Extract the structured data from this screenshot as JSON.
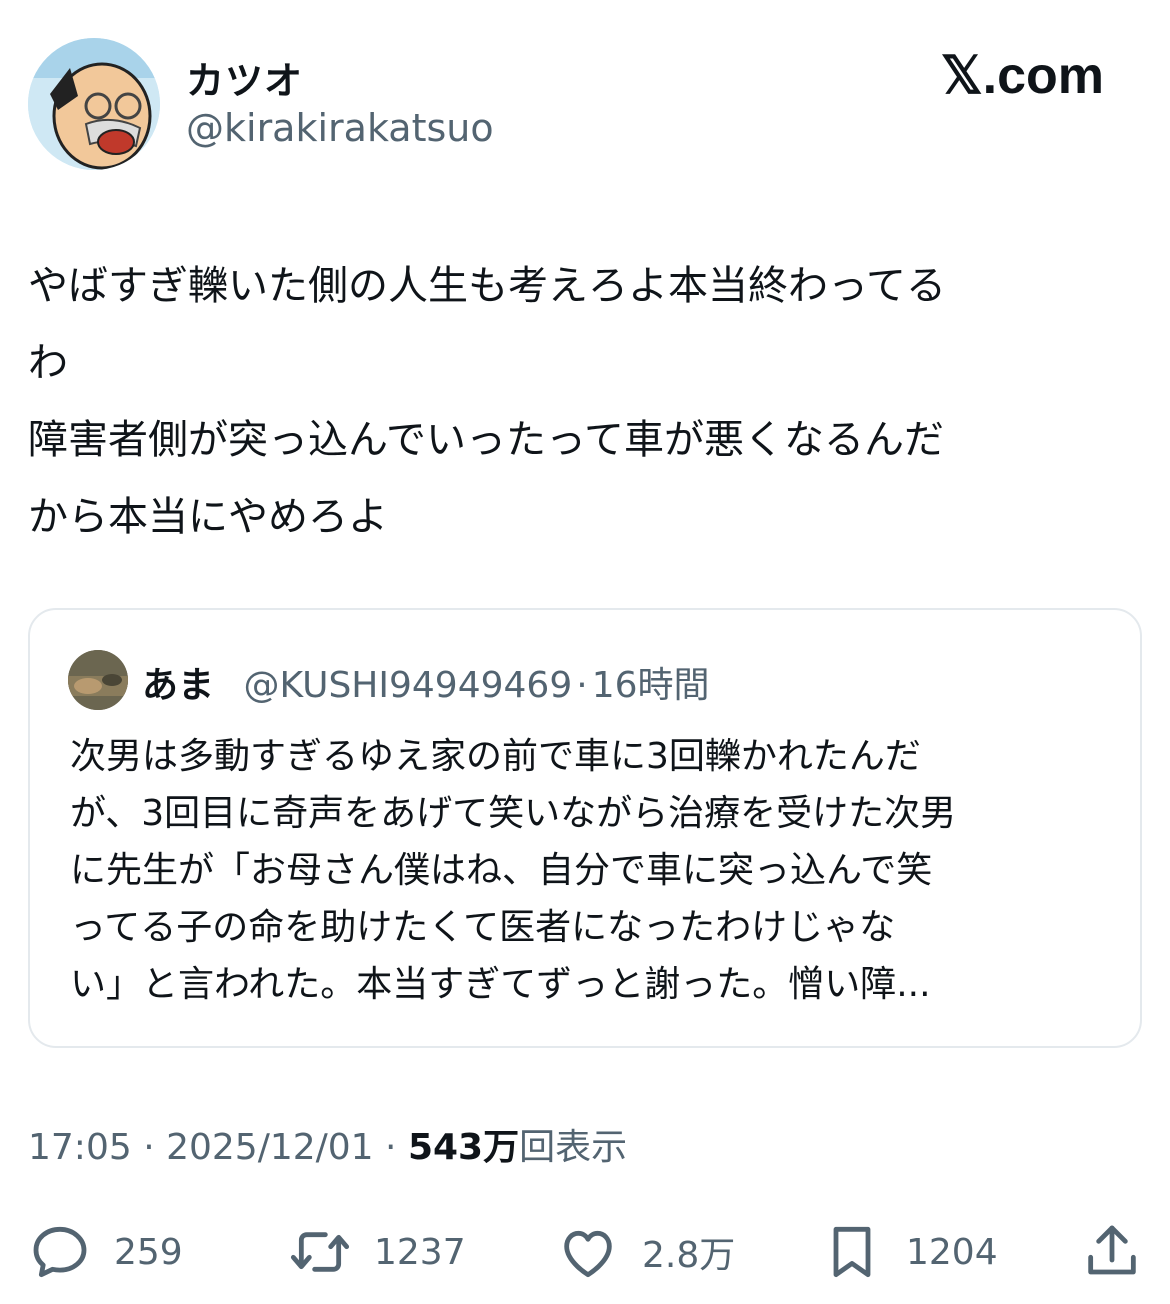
{
  "author": {
    "display_name": "カツオ",
    "handle": "@kirakirakatsuo",
    "avatar_icon": "avatar-cartoon-old-man-icon"
  },
  "brand": "𝕏.com",
  "tweet": {
    "text": "やばすぎ轢いた側の人生も考えろよ本当終わってる\nわ\n障害者側が突っ込んでいったって車が悪くなるんだ\nから本当にやめろよ"
  },
  "quote": {
    "name": "あま",
    "handle": "@KUSHI94949469",
    "dot": "·",
    "time": "16時間",
    "avatar_icon": "avatar-photo-icon",
    "text": "次男は多動すぎるゆえ家の前で車に3回轢かれたんだ\nが、3回目に奇声をあげて笑いながら治療を受けた次男\nに先生が「お母さん僕はね、自分で車に突っ込んで笑\nってる子の命を助けたくて医者になったわけじゃな\nい」と言われた。本当すぎてずっと謝った。憎い障..."
  },
  "meta": {
    "time": "17:05",
    "sep1": " · ",
    "date": "2025/12/01",
    "sep2": " · ",
    "views_count": "543万",
    "views_label": "回表示"
  },
  "actions": {
    "replies": "259",
    "reposts": "1237",
    "likes": "2.8万",
    "bookmarks": "1204",
    "icons": [
      "reply-icon",
      "repost-icon",
      "like-icon",
      "bookmark-icon",
      "share-icon"
    ]
  },
  "colors": {
    "text": "#0f1419",
    "secondary": "#536471",
    "border": "#e4e9ed"
  }
}
